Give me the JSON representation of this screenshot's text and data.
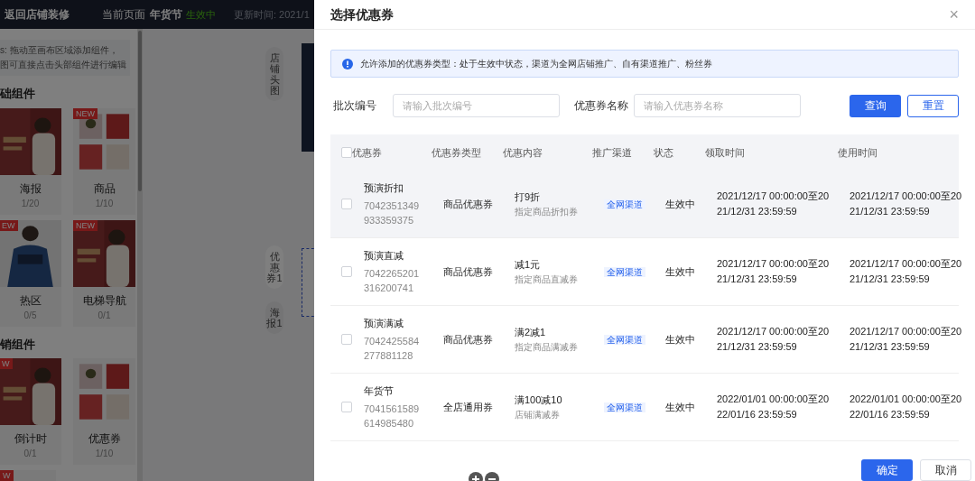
{
  "topbar": {
    "back": "返回店铺装修",
    "page_label": "当前页面",
    "page_name": "年货节",
    "page_status": "生效中",
    "updated": "更新时间: 2021/1"
  },
  "sidebar": {
    "tips": [
      "s: 拖动至画布区域添加组件，",
      "图可直接点击头部组件进行编辑"
    ],
    "sections": [
      {
        "title": "础组件",
        "cards": [
          {
            "name": "海报",
            "count": "1/20"
          },
          {
            "name": "商品",
            "count": "1/10",
            "badge": "NEW"
          },
          {
            "name": "热区",
            "count": "0/5",
            "badge": "EW"
          },
          {
            "name": "电梯导航",
            "count": "0/1",
            "badge": "NEW"
          }
        ]
      },
      {
        "title": "销组件",
        "cards": [
          {
            "name": "倒计时",
            "count": "0/1",
            "badge": "W"
          },
          {
            "name": "优惠券",
            "count": "1/10"
          }
        ]
      }
    ],
    "more_badge": "W"
  },
  "canvas_tabs": [
    {
      "label": "店铺头图",
      "selected": false
    },
    {
      "label": "优惠券1",
      "selected": true
    },
    {
      "label": "海报1",
      "selected": false
    }
  ],
  "dialog": {
    "title": "选择优惠券",
    "close": "×",
    "notice": "允许添加的优惠券类型：处于生效中状态，渠道为全网店铺推广、自有渠道推广、粉丝券",
    "filters": [
      {
        "label": "批次编号",
        "placeholder": "请输入批次编号"
      },
      {
        "label": "优惠券名称",
        "placeholder": "请输入优惠券名称"
      }
    ],
    "search_button": "查询",
    "reset_button": "重置",
    "table": {
      "select_all": false,
      "columns": [
        "优惠券",
        "优惠券类型",
        "优惠内容",
        "推广渠道",
        "状态",
        "领取时间",
        "使用时间"
      ],
      "rows": [
        {
          "checked": false,
          "highlighted": true,
          "name": "预演折扣",
          "id": "7042351349933359375",
          "type": "商品优惠券",
          "offer": "打9折",
          "offer_desc": "指定商品折扣券",
          "channel": "全网渠道",
          "status": "生效中",
          "claim_time": "2021/12/17 00:00:00至2021/12/31 23:59:59",
          "use_time": "2021/12/17 00:00:00至2021/12/31 23:59:59"
        },
        {
          "checked": false,
          "highlighted": false,
          "name": "预演直减",
          "id": "7042265201316200741",
          "type": "商品优惠券",
          "offer": "减1元",
          "offer_desc": "指定商品直减券",
          "channel": "全网渠道",
          "status": "生效中",
          "claim_time": "2021/12/17 00:00:00至2021/12/31 23:59:59",
          "use_time": "2021/12/17 00:00:00至2021/12/31 23:59:59"
        },
        {
          "checked": false,
          "highlighted": false,
          "name": "预演满减",
          "id": "7042425584277881128",
          "type": "商品优惠券",
          "offer": "满2减1",
          "offer_desc": "指定商品满减券",
          "channel": "全网渠道",
          "status": "生效中",
          "claim_time": "2021/12/17 00:00:00至2021/12/31 23:59:59",
          "use_time": "2021/12/17 00:00:00至2021/12/31 23:59:59"
        },
        {
          "checked": false,
          "highlighted": false,
          "name": "年货节",
          "id": "7041561589614985480",
          "type": "全店通用券",
          "offer": "满100减10",
          "offer_desc": "店铺满减券",
          "channel": "全网渠道",
          "status": "生效中",
          "claim_time": "2022/01/01 00:00:00至2022/01/16 23:59:59",
          "use_time": "2022/01/01 00:00:00至2022/01/16 23:59:59"
        }
      ]
    },
    "confirm_button": "确定",
    "cancel_button": "取消"
  }
}
